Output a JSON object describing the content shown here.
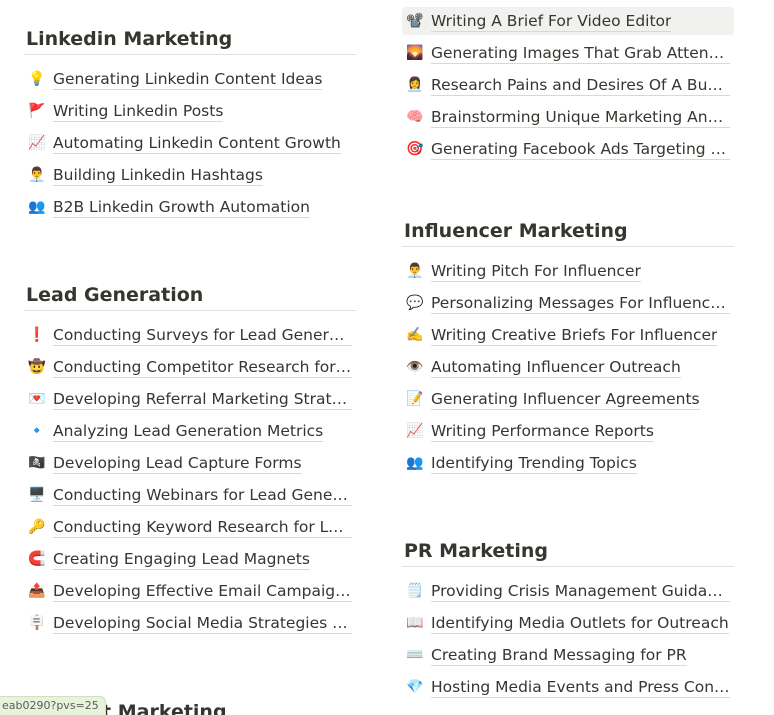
{
  "left": {
    "sections": [
      {
        "title": "Linkedin Marketing",
        "items": [
          {
            "icon": "💡",
            "icon_name": "lightbulb-icon",
            "label": "Generating Linkedin Content Ideas"
          },
          {
            "icon": "🚩",
            "icon_name": "red-flag-icon",
            "label": "Writing Linkedin Posts"
          },
          {
            "icon": "📈",
            "icon_name": "chart-up-icon",
            "label": "Automating Linkedin Content Growth"
          },
          {
            "icon": "👨‍💼",
            "icon_name": "person-icon",
            "label": "Building Linkedin Hashtags"
          },
          {
            "icon": "👥",
            "icon_name": "people-icon",
            "label": "B2B Linkedin Growth Automation"
          }
        ]
      },
      {
        "title": "Lead Generation",
        "items": [
          {
            "icon": "❗",
            "icon_name": "exclamation-icon",
            "label": "Conducting Surveys for Lead Generation"
          },
          {
            "icon": "🤠",
            "icon_name": "cowboy-face-icon",
            "label": "Conducting Competitor Research for Lead Generation"
          },
          {
            "icon": "💌",
            "icon_name": "love-letter-icon",
            "label": "Developing Referral Marketing Strategies"
          },
          {
            "icon": "🔹",
            "icon_name": "blue-diamond-icon",
            "label": "Analyzing Lead Generation Metrics"
          },
          {
            "icon": "🏴‍☠️",
            "icon_name": "pirate-flag-icon",
            "label": "Developing Lead Capture Forms"
          },
          {
            "icon": "🖥️",
            "icon_name": "desktop-computer-icon",
            "label": "Conducting Webinars for Lead Generation"
          },
          {
            "icon": "🔑",
            "icon_name": "key-icon",
            "label": "Conducting Keyword Research for Lead Generation"
          },
          {
            "icon": "🧲",
            "icon_name": "magnet-icon",
            "label": "Creating Engaging Lead Magnets"
          },
          {
            "icon": "📤",
            "icon_name": "outbox-tray-icon",
            "label": "Developing Effective Email Campaigns for Lead Generation"
          },
          {
            "icon": "🪧",
            "icon_name": "placard-icon",
            "label": "Developing Social Media Strategies for Lead Generation"
          }
        ]
      }
    ],
    "clipped_heading": "Content Marketing"
  },
  "right": {
    "top_items": [
      {
        "icon": "📽️",
        "icon_name": "film-projector-icon",
        "label": "Writing A Brief For Video Editor",
        "highlighted": true
      },
      {
        "icon": "🌄",
        "icon_name": "sunrise-image-icon",
        "label": "Generating Images That Grab Attention"
      },
      {
        "icon": "👩‍💼",
        "icon_name": "person-icon",
        "label": "Research Pains and Desires Of A Buyer Persona"
      },
      {
        "icon": "🧠",
        "icon_name": "brain-icon",
        "label": "Brainstorming Unique Marketing Angles"
      },
      {
        "icon": "🎯",
        "icon_name": "target-icon",
        "label": "Generating Facebook Ads Targeting Ideas"
      }
    ],
    "sections": [
      {
        "title": "Influencer Marketing",
        "items": [
          {
            "icon": "👨‍💼",
            "icon_name": "person-icon",
            "label": "Writing Pitch For Influencer"
          },
          {
            "icon": "💬",
            "icon_name": "speech-bubble-icon",
            "label": "Personalizing Messages For Influencers"
          },
          {
            "icon": "✍️",
            "icon_name": "writing-hand-icon",
            "label": "Writing Creative Briefs For Influencer"
          },
          {
            "icon": "👁️",
            "icon_name": "eye-icon",
            "label": "Automating Influencer Outreach"
          },
          {
            "icon": "📝",
            "icon_name": "memo-icon",
            "label": "Generating Influencer Agreements"
          },
          {
            "icon": "📈",
            "icon_name": "chart-up-icon",
            "label": "Writing Performance Reports"
          },
          {
            "icon": "👥",
            "icon_name": "people-icon",
            "label": "Identifying Trending Topics"
          }
        ]
      },
      {
        "title": "PR Marketing",
        "items": [
          {
            "icon": "🗒️",
            "icon_name": "notepad-icon",
            "label": "Providing Crisis Management Guidance"
          },
          {
            "icon": "📖",
            "icon_name": "open-book-icon",
            "label": "Identifying Media Outlets for Outreach"
          },
          {
            "icon": "⌨️",
            "icon_name": "keyboard-icon",
            "label": "Creating Brand Messaging for PR"
          },
          {
            "icon": "💎",
            "icon_name": "gem-icon",
            "label": "Hosting Media Events and Press Conferences"
          }
        ]
      }
    ]
  },
  "status_bar": {
    "text": "eab0290?pvs=25"
  }
}
